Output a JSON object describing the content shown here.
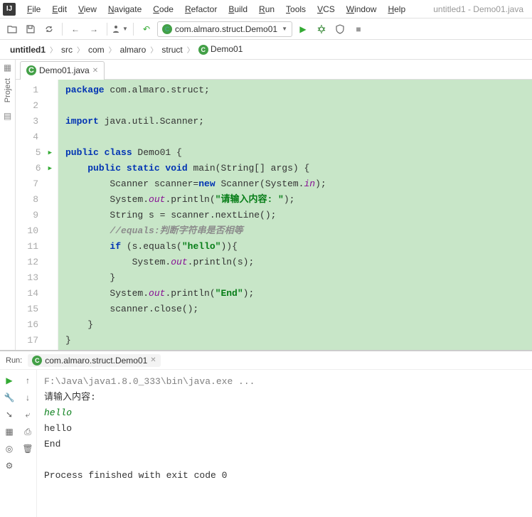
{
  "window": {
    "title": "untitled1 - Demo01.java"
  },
  "menu": [
    "File",
    "Edit",
    "View",
    "Navigate",
    "Code",
    "Refactor",
    "Build",
    "Run",
    "Tools",
    "VCS",
    "Window",
    "Help"
  ],
  "toolbar": {
    "run_config": "com.almaro.struct.Demo01"
  },
  "breadcrumbs": [
    "untitled1",
    "src",
    "com",
    "almaro",
    "struct",
    "Demo01"
  ],
  "tab": {
    "label": "Demo01.java"
  },
  "side": {
    "project": "Project"
  },
  "code": {
    "lines": [
      {
        "n": 1,
        "html": "<span class='kw'>package</span> com.almaro.struct;"
      },
      {
        "n": 2,
        "html": ""
      },
      {
        "n": 3,
        "html": "<span class='kw'>import</span> java.util.Scanner;"
      },
      {
        "n": 4,
        "html": ""
      },
      {
        "n": 5,
        "run": true,
        "html": "<span class='kw'>public class</span> Demo01 {"
      },
      {
        "n": 6,
        "run": true,
        "html": "    <span class='kw'>public static void</span> main(String[] args) {"
      },
      {
        "n": 7,
        "html": "        Scanner scanner=<span class='kw'>new</span> Scanner(System.<span class='fld'>in</span>);"
      },
      {
        "n": 8,
        "html": "        System.<span class='fld'>out</span>.println(<span class='str'>\"请输入内容: \"</span>);"
      },
      {
        "n": 9,
        "html": "        String s = scanner.nextLine();"
      },
      {
        "n": 10,
        "html": "        <span class='cmt'>//equals:判断字符串是否相等</span>"
      },
      {
        "n": 11,
        "html": "        <span class='kw'>if</span> (s.equals(<span class='str'>\"hello\"</span>)){"
      },
      {
        "n": 12,
        "html": "            System.<span class='fld'>out</span>.println(s);"
      },
      {
        "n": 13,
        "html": "        }"
      },
      {
        "n": 14,
        "html": "        System.<span class='fld'>out</span>.println(<span class='str'>\"End\"</span>);"
      },
      {
        "n": 15,
        "html": "        scanner.close();"
      },
      {
        "n": 16,
        "html": "    }"
      },
      {
        "n": 17,
        "html": "}"
      }
    ]
  },
  "run": {
    "label": "Run:",
    "tab": "com.almaro.struct.Demo01",
    "console": [
      {
        "cls": "con-cmd",
        "text": "F:\\Java\\java1.8.0_333\\bin\\java.exe ..."
      },
      {
        "cls": "",
        "text": "请输入内容:"
      },
      {
        "cls": "con-in",
        "text": "hello"
      },
      {
        "cls": "",
        "text": "hello"
      },
      {
        "cls": "",
        "text": "End"
      },
      {
        "cls": "",
        "text": ""
      },
      {
        "cls": "con-exit",
        "text": "Process finished with exit code 0"
      }
    ]
  }
}
